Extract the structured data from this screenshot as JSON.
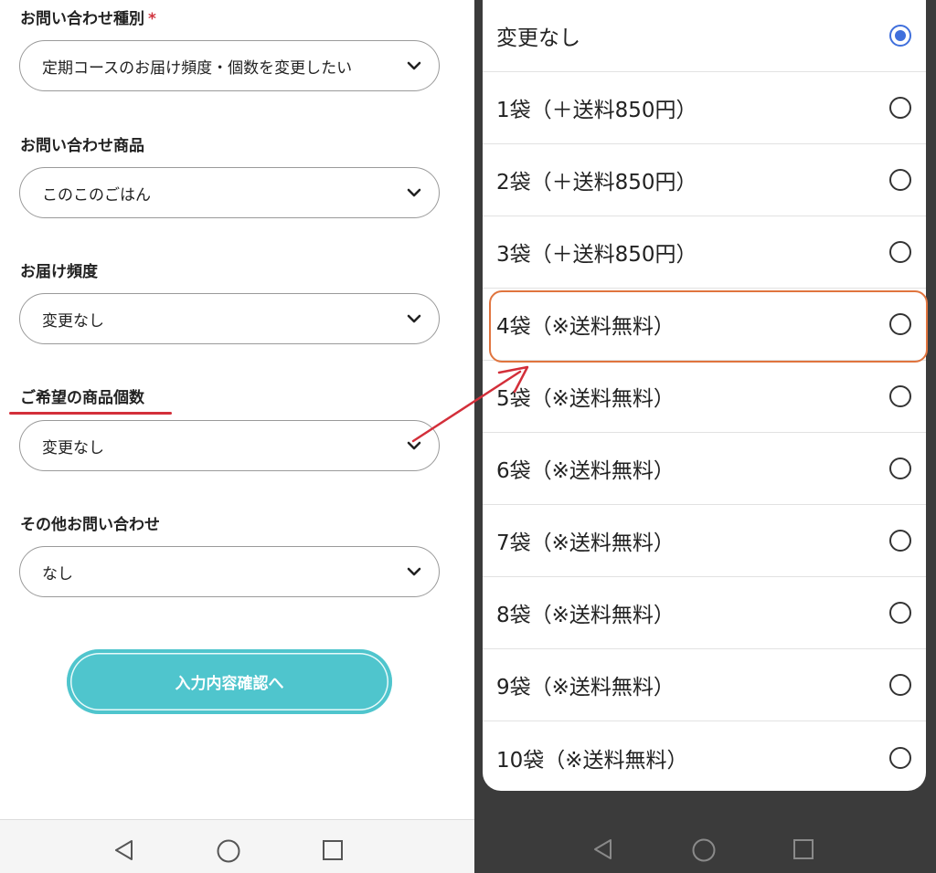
{
  "form": {
    "inquiry_type": {
      "label": "お問い合わせ種別",
      "required_mark": "*",
      "value": "定期コースのお届け頻度・個数を変更したい"
    },
    "product": {
      "label": "お問い合わせ商品",
      "value": "このこのごはん"
    },
    "frequency": {
      "label": "お届け頻度",
      "value": "変更なし"
    },
    "quantity": {
      "label": "ご希望の商品個数",
      "value": "変更なし"
    },
    "other": {
      "label": "その他お問い合わせ",
      "value": "なし"
    },
    "confirm_label": "入力内容確認へ"
  },
  "dialog": {
    "options": [
      {
        "label": "変更なし",
        "selected": true
      },
      {
        "label": "1袋（＋送料850円）",
        "selected": false
      },
      {
        "label": "2袋（＋送料850円）",
        "selected": false
      },
      {
        "label": "3袋（＋送料850円）",
        "selected": false
      },
      {
        "label": "4袋（※送料無料）",
        "selected": false
      },
      {
        "label": "5袋（※送料無料）",
        "selected": false
      },
      {
        "label": "6袋（※送料無料）",
        "selected": false
      },
      {
        "label": "7袋（※送料無料）",
        "selected": false
      },
      {
        "label": "8袋（※送料無料）",
        "selected": false
      },
      {
        "label": "9袋（※送料無料）",
        "selected": false
      },
      {
        "label": "10袋（※送料無料）",
        "selected": false
      }
    ],
    "highlighted_option": "4袋（※送料無料）"
  },
  "icons": {
    "dropdown": "chevron-down-icon",
    "nav": [
      "back-triangle-icon",
      "home-circle-icon",
      "recents-square-icon"
    ]
  },
  "colors": {
    "accent_button": "#4fc5cd",
    "annotation_red": "#d32f3a",
    "highlight_orange": "#e0743e",
    "radio_selected": "#3f6fdc"
  }
}
